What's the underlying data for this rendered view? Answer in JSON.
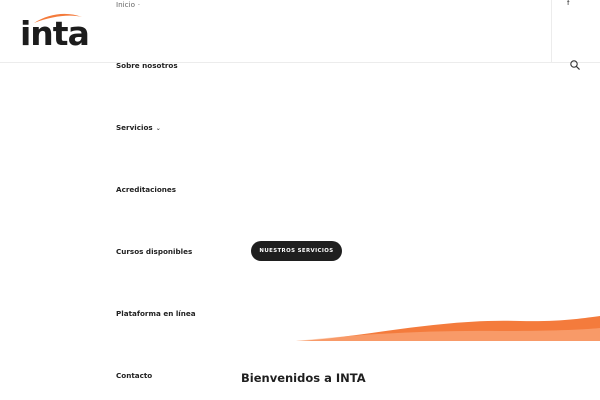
{
  "brand": {
    "logo_text": "inta",
    "accent": "#f47b3c"
  },
  "nav": {
    "items": [
      {
        "label": "Inicio",
        "has_dropdown": true
      },
      {
        "label": "Sobre nosotros",
        "has_dropdown": false
      },
      {
        "label": "Servicios",
        "has_dropdown": true
      },
      {
        "label": "Acreditaciones",
        "has_dropdown": false
      },
      {
        "label": "Cursos disponibles",
        "has_dropdown": false
      },
      {
        "label": "Plataforma en línea",
        "has_dropdown": false
      },
      {
        "label": "Contacto",
        "has_dropdown": false
      }
    ]
  },
  "header": {
    "social_icon": "facebook-icon",
    "search_icon": "search-icon"
  },
  "hero": {
    "cta_label": "NUESTROS SERVICIOS"
  },
  "intro": {
    "title": "Bienvenidos a INTA"
  },
  "colors": {
    "cta_bg": "#1f1f1f",
    "wave": "#f47b3c",
    "text": "#1f1f1f"
  }
}
